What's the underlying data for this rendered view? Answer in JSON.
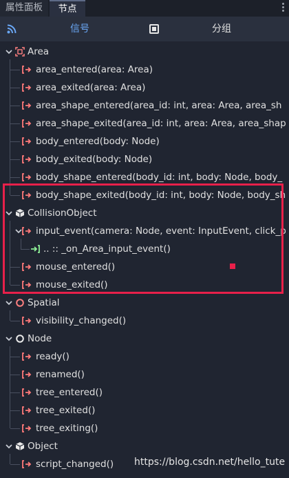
{
  "tabs": [
    {
      "label": "属性面板",
      "active": false
    },
    {
      "label": "节点",
      "active": true
    }
  ],
  "toolbar": {
    "signal_label": "信号",
    "group_label": "分组",
    "accent_color": "#6aa7f5"
  },
  "tree": {
    "area": {
      "label": "Area",
      "signals": [
        "area_entered(area: Area)",
        "area_exited(area: Area)",
        "area_shape_entered(area_id: int, area: Area, area_sh",
        "area_shape_exited(area_id: int, area: Area, area_shap",
        "body_entered(body: Node)",
        "body_exited(body: Node)",
        "body_shape_entered(body_id: int, body: Node, body_",
        "body_shape_exited(body_id: int, body: Node, body_sh"
      ]
    },
    "collision_object": {
      "label": "CollisionObject",
      "signals": [
        "input_event(camera: Node, event: InputEvent, click_p",
        "mouse_entered()",
        "mouse_exited()"
      ],
      "connection": ".. :: _on_Area_input_event()"
    },
    "spatial": {
      "label": "Spatial",
      "signals": [
        "visibility_changed()"
      ]
    },
    "node": {
      "label": "Node",
      "signals": [
        "ready()",
        "renamed()",
        "tree_entered()",
        "tree_exited()",
        "tree_exiting()"
      ]
    },
    "object": {
      "label": "Object",
      "signals": [
        "script_changed()"
      ]
    }
  },
  "watermark": "https://blog.csdn.net/hello_tute",
  "colors": {
    "signal_icon": "#ff7a7a",
    "connection_icon": "#8eef97",
    "highlight": "#e8204a",
    "background": "#202531"
  }
}
